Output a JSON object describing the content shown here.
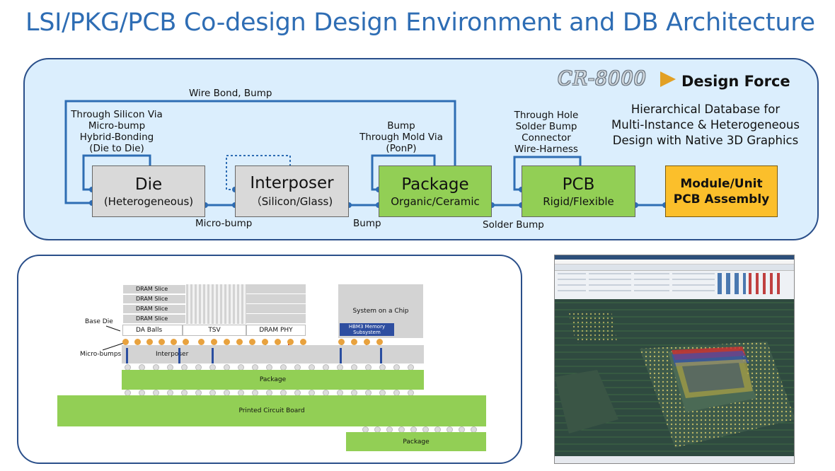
{
  "title": "LSI/PKG/PCB Co-design Design Environment and DB Architecture",
  "logo": {
    "product": "CR-8000",
    "brand": "Design Force"
  },
  "hierarchy_text": [
    "Hierarchical Database for",
    "Multi-Instance & Heterogeneous",
    "Design with Native 3D Graphics"
  ],
  "boxes": {
    "die": {
      "name": "Die",
      "sub": "(Heterogeneous)"
    },
    "interposer": {
      "name": "Interposer",
      "sub": "（Silicon/Glass)"
    },
    "package": {
      "name": "Package",
      "sub": "Organic/Ceramic"
    },
    "pcb": {
      "name": "PCB",
      "sub": "Rigid/Flexible"
    },
    "module": {
      "line1": "Module/Unit",
      "line2": "PCB Assembly"
    }
  },
  "labels": {
    "wire_bond": "Wire Bond, Bump",
    "die_conn": [
      "Through Silicon Via",
      "Micro-bump",
      "Hybrid-Bonding",
      "(Die to Die)"
    ],
    "pkg_conn": [
      "Bump",
      "Through Mold Via",
      "(PonP)"
    ],
    "pcb_conn": [
      "Through Hole",
      "Solder Bump",
      "Connector",
      "Wire-Harness"
    ],
    "micro_bump": "Micro-bump",
    "bump": "Bump",
    "solder_bump": "Solder Bump"
  },
  "stack": {
    "dram_slice": "DRAM Slice",
    "base_die": "Base Die",
    "micro_bumps": "Micro-bumps",
    "da_balls": "DA Balls",
    "tsv": "TSV",
    "dram_phy": "DRAM PHY",
    "soc": "System on a Chip",
    "hbm_line1": "HBM3 Memory",
    "hbm_line2": "Subsystem",
    "interposer": "Interposer",
    "package": "Package",
    "pcb": "Printed Circuit Board",
    "package2": "Package"
  },
  "colors": {
    "title": "#2e6db4",
    "line": "#2e6db4",
    "green_box": "#92cf55",
    "gold_box": "#fbbf2b",
    "gray_box": "#d9d9d9",
    "bump": "#e8a23e"
  }
}
